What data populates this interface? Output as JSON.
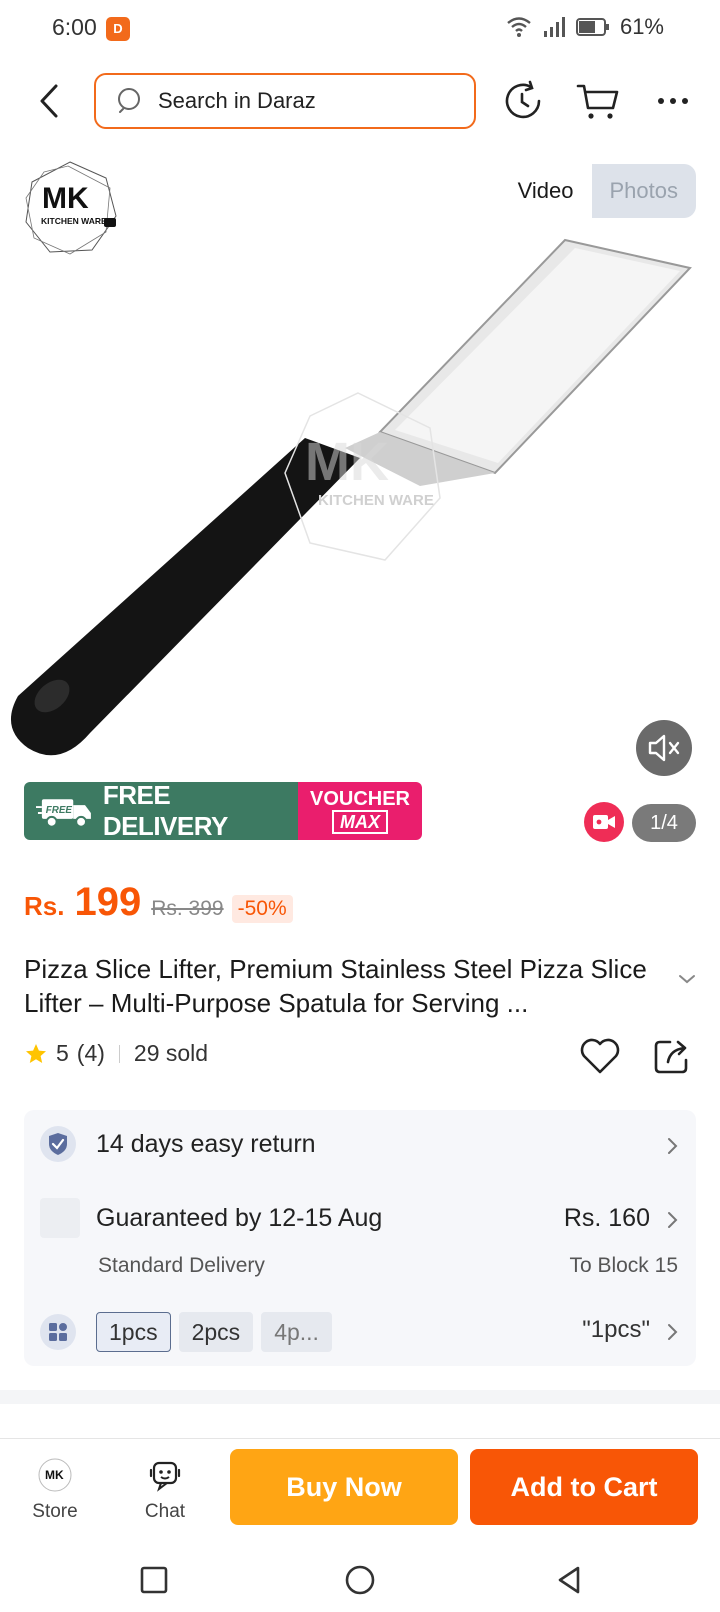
{
  "status_bar": {
    "time": "6:00",
    "battery": "61%",
    "app_icon": "daraz-notification-icon"
  },
  "search": {
    "placeholder": "Search in Daraz"
  },
  "media": {
    "brand_line1": "MK",
    "brand_line2": "KITCHEN WARE",
    "tabs": [
      "Video",
      "Photos"
    ],
    "active_tab": "Video",
    "free_delivery": "FREE DELIVERY",
    "free_tag": "FREE",
    "voucher_line1": "VOUCHER",
    "voucher_line2": "MAX",
    "counter": "1/4"
  },
  "price": {
    "currency": "Rs.",
    "current": "199",
    "original": "Rs. 399",
    "discount": "-50%"
  },
  "product": {
    "title": "Pizza Slice Lifter, Premium Stainless Steel Pizza Slice Lifter – Multi-Purpose Spatula for Serving ...",
    "rating": "5",
    "reviews": "(4)",
    "sold": "29 sold"
  },
  "info": {
    "return": "14 days easy return",
    "delivery_title": "Guaranteed by 12-15 Aug",
    "delivery_type": "Standard Delivery",
    "delivery_price": "Rs. 160",
    "delivery_to": "To Block 15",
    "variants": [
      "1pcs",
      "2pcs",
      "4p..."
    ],
    "selected_variant": "\"1pcs\""
  },
  "bottom_bar": {
    "store": "Store",
    "chat": "Chat",
    "buy_now": "Buy Now",
    "add_to_cart": "Add to Cart",
    "store_logo": "MK"
  },
  "colors": {
    "accent": "#f85606",
    "buy_now": "#ffa514",
    "free_delivery": "#3d7a62",
    "voucher": "#ea1e6d"
  }
}
